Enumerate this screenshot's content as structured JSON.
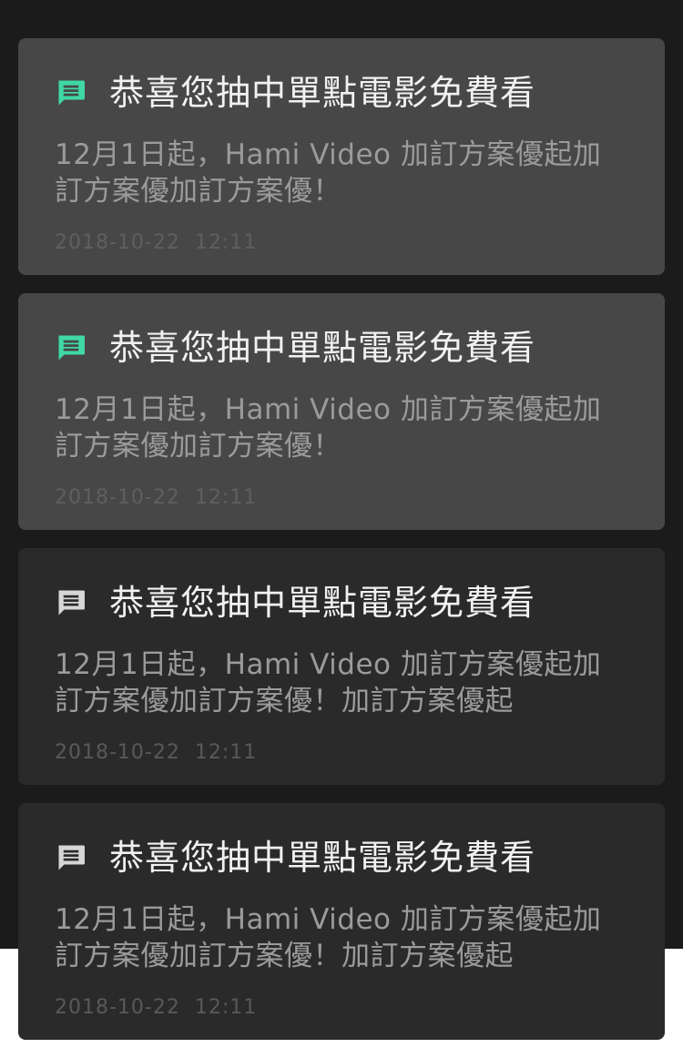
{
  "notifications": [
    {
      "title": "恭喜您抽中單點電影免費看",
      "body": "12月1日起，Hami Video 加訂方案優起加訂方案優加訂方案優！",
      "timestamp": "2018-10-22  12:11",
      "unread": true,
      "icon": "message-icon",
      "icon_color": "#3fd8a6"
    },
    {
      "title": "恭喜您抽中單點電影免費看",
      "body": "12月1日起，Hami Video 加訂方案優起加訂方案優加訂方案優！",
      "timestamp": "2018-10-22  12:11",
      "unread": true,
      "icon": "message-icon",
      "icon_color": "#3fd8a6"
    },
    {
      "title": "恭喜您抽中單點電影免費看",
      "body": "12月1日起，Hami Video 加訂方案優起加訂方案優加訂方案優！加訂方案優起",
      "timestamp": "2018-10-22  12:11",
      "unread": false,
      "icon": "message-icon",
      "icon_color": "#d6d6d6"
    },
    {
      "title": "恭喜您抽中單點電影免費看",
      "body": "12月1日起，Hami Video 加訂方案優起加訂方案優加訂方案優！加訂方案優起",
      "timestamp": "2018-10-22  12:11",
      "unread": false,
      "icon": "message-icon",
      "icon_color": "#d6d6d6"
    }
  ]
}
